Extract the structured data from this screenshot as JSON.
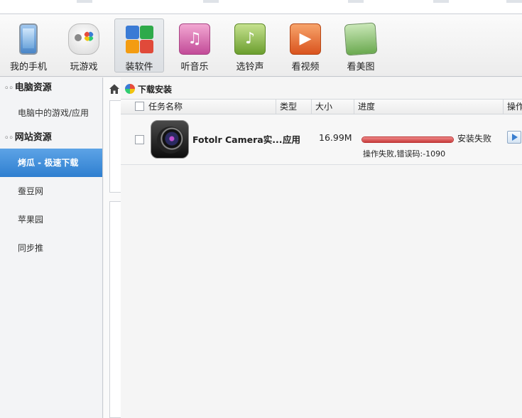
{
  "toolbar": {
    "items": [
      {
        "label": "我的手机",
        "icon": "phone-icon"
      },
      {
        "label": "玩游戏",
        "icon": "gamepad-icon"
      },
      {
        "label": "装软件",
        "icon": "apps-icon"
      },
      {
        "label": "听音乐",
        "icon": "music-note-icon"
      },
      {
        "label": "选铃声",
        "icon": "bell-icon"
      },
      {
        "label": "看视频",
        "icon": "play-icon"
      },
      {
        "label": "看美图",
        "icon": "picture-icon"
      }
    ],
    "active": "装软件"
  },
  "sidebar": {
    "sections": [
      {
        "title": "电脑资源",
        "items": [
          {
            "label": "电脑中的游戏/应用"
          }
        ]
      },
      {
        "title": "网站资源",
        "items": [
          {
            "label": "烤瓜 - 极速下载",
            "active": true
          },
          {
            "label": "蚕豆网"
          },
          {
            "label": "苹果园"
          },
          {
            "label": "同步推"
          }
        ]
      }
    ]
  },
  "main": {
    "breadcrumb": "下载安装",
    "columns": {
      "name": "任务名称",
      "type": "类型",
      "size": "大小",
      "progress": "进度",
      "action": "操作"
    },
    "rows": [
      {
        "name": "Fotolr Camera实...",
        "type": "应用",
        "size": "16.99M",
        "status": "安装失败",
        "error": "操作失败,错误码:-1090",
        "progress_percent": 100
      }
    ]
  },
  "colors": {
    "accent": "#2e7fd0",
    "progress_fail": "#c93c3c"
  }
}
